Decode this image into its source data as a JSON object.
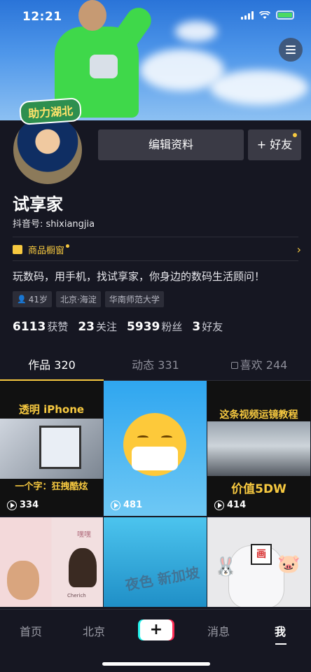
{
  "status_bar": {
    "time": "12:21"
  },
  "header": {
    "sticker_text": "助力湖北"
  },
  "profile": {
    "edit_button": "编辑资料",
    "friend_button": "+ 好友",
    "name": "试享家",
    "douyin_id": "抖音号: shixiangjia",
    "shop_label": "商品橱窗",
    "bio": "玩数码，用手机，找试享家，你身边的数码生活顾问！",
    "tags": [
      {
        "icon": "person-icon",
        "label": "41岁"
      },
      {
        "label": "北京·海淀"
      },
      {
        "label": "华南师范大学"
      }
    ],
    "stats": [
      {
        "value": "6113",
        "label": "获赞"
      },
      {
        "value": "23",
        "label": "关注"
      },
      {
        "value": "5939",
        "label": "粉丝"
      },
      {
        "value": "3",
        "label": "好友"
      }
    ]
  },
  "tabs": [
    {
      "label": "作品 320",
      "active": true
    },
    {
      "label": "动态 331",
      "active": false
    },
    {
      "label": "喜欢 244",
      "active": false,
      "icon": "lock-icon"
    }
  ],
  "videos": [
    {
      "title_top": "透明 iPhone",
      "title_bottom": "一个字：狂拽酷炫",
      "plays": "334"
    },
    {
      "plays": "481"
    },
    {
      "title_top": "这条视频运镜教程",
      "title_bottom": "价值5DW",
      "plays": "414"
    },
    {
      "caption": "Cherich",
      "overlay": "嘿嘿"
    },
    {
      "overlay": "夜色 新加坡"
    },
    {
      "overlay": "画"
    }
  ],
  "navbar": {
    "items": [
      "首页",
      "北京",
      "消息",
      "我"
    ],
    "plus": "+"
  },
  "colors": {
    "background": "#161722",
    "accent": "#f7c940",
    "button": "#3a3a45"
  }
}
